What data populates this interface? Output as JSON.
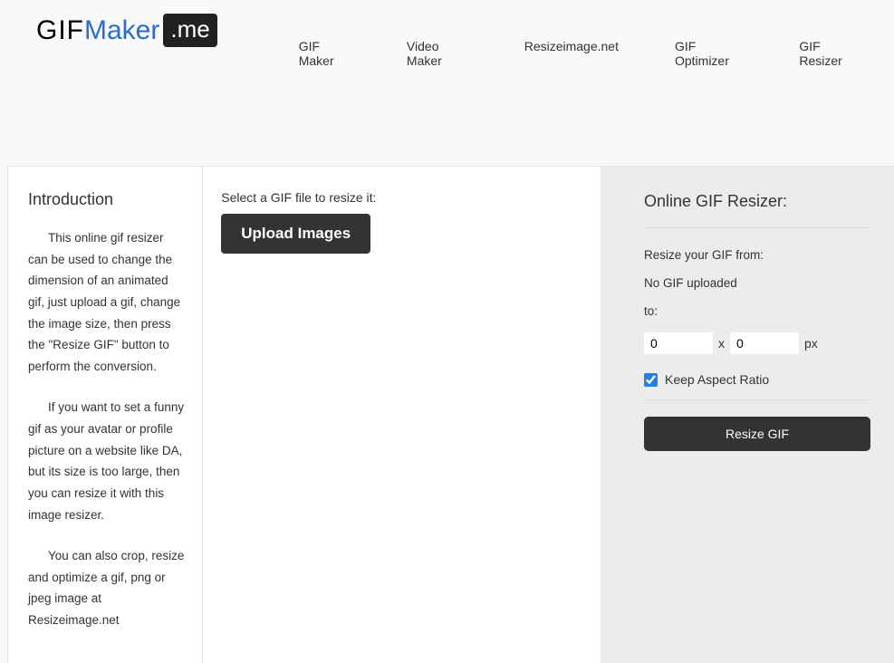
{
  "logo": {
    "part1": "GIF",
    "part2": "Maker",
    "part3": ".me"
  },
  "nav": {
    "items": [
      "GIF Maker",
      "Video Maker",
      "Resizeimage.net",
      "GIF Optimizer",
      "GIF Resizer"
    ]
  },
  "intro": {
    "heading": "Introduction",
    "p1": "This online gif resizer can be used to change the dimension of an animated gif, just upload a gif, change the image size, then press the \"Resize GIF\" button to perform the conversion.",
    "p2": "If you want to set a funny gif as your avatar or profile picture on a website like DA, but its size is too large, then you can resize it with this image resizer.",
    "p3": "You can also crop, resize and optimize a gif, png or jpeg image at Resizeimage.net"
  },
  "middle": {
    "selectLabel": "Select a GIF file to resize it:",
    "uploadBtn": "Upload Images"
  },
  "right": {
    "heading": "Online GIF Resizer:",
    "resizeFrom": "Resize your GIF from:",
    "noGif": "No GIF uploaded",
    "to": "to:",
    "width": "0",
    "height": "0",
    "x": "x",
    "px": "px",
    "keepAspect": "Keep Aspect Ratio",
    "resizeBtn": "Resize GIF"
  }
}
